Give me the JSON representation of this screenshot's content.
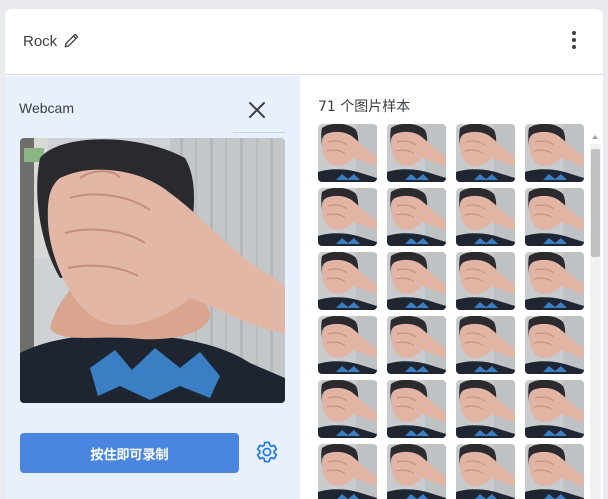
{
  "header": {
    "class_name": "Rock",
    "edit_icon": "pencil-icon",
    "menu_icon": "more-vert-icon"
  },
  "webcam_panel": {
    "label": "Webcam",
    "close_icon": "close-icon",
    "record_button_label": "按住即可录制",
    "settings_icon": "gear-icon"
  },
  "samples_panel": {
    "count_label": "71 个图片样本",
    "visible_rows": 6,
    "columns": 4
  },
  "colors": {
    "accent": "#4a86e0",
    "left_panel_bg": "#e8f0fe",
    "settings_icon": "#1a73e8"
  }
}
